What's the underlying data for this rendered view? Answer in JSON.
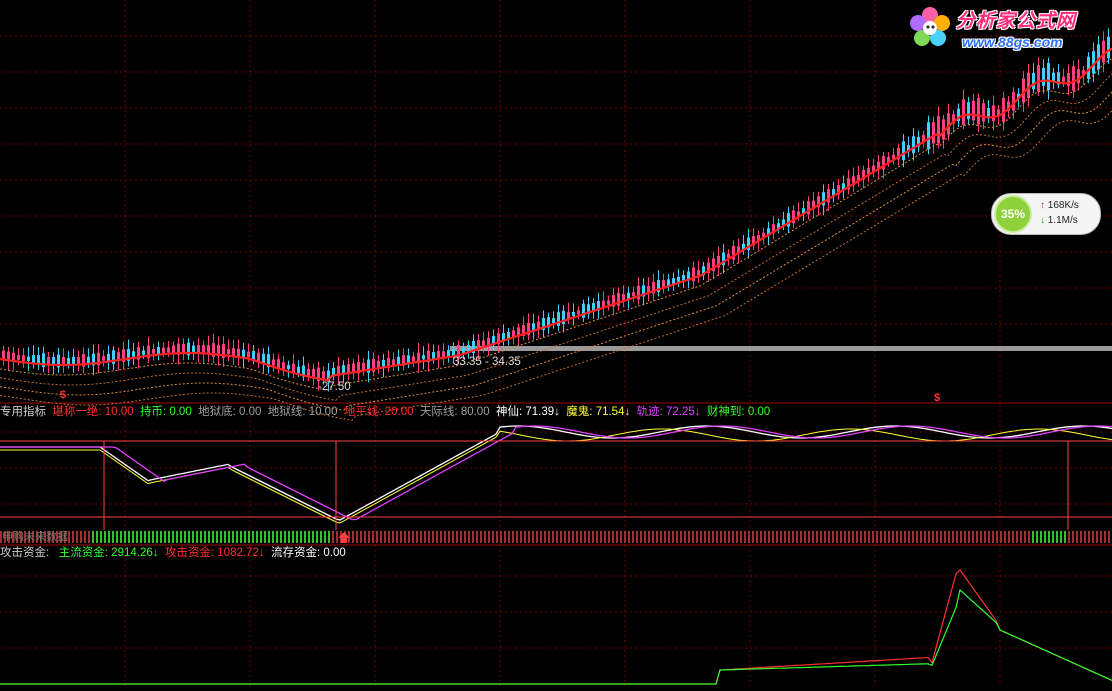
{
  "chart_data": [
    {
      "type": "candlestick",
      "panel": "price",
      "annotations": {
        "high_label": "33.35 - 34.35",
        "low_label": "27.50"
      }
    },
    {
      "type": "line",
      "panel": "indicator",
      "title": "专用指标",
      "legend": [
        {
          "name": "堪称一绝",
          "value": "10.00",
          "color": "#ff3030"
        },
        {
          "name": "持币",
          "value": "0.00",
          "color": "#30ff30"
        },
        {
          "name": "地狱底",
          "value": "0.00",
          "color": "#a0a0a0"
        },
        {
          "name": "地狱线",
          "value": "10.00",
          "color": "#a0a0a0"
        },
        {
          "name": "地平线",
          "value": "20.00",
          "color": "#ff3030"
        },
        {
          "name": "天际线",
          "value": "80.00",
          "color": "#a0a0a0"
        },
        {
          "name": "神仙",
          "value": "71.39",
          "color": "#ffffff",
          "arrow": "down"
        },
        {
          "name": "魔鬼",
          "value": "71.54",
          "color": "#ffff30",
          "arrow": "down"
        },
        {
          "name": "轨迹",
          "value": "72.25",
          "color": "#e040ff",
          "arrow": "down"
        },
        {
          "name": "财神到",
          "value": "0.00",
          "color": "#30ff30"
        }
      ]
    },
    {
      "type": "line",
      "panel": "capital",
      "legend": [
        {
          "name": "攻击资金",
          "value": "",
          "color": "#ffffff"
        },
        {
          "name": "主流资金",
          "value": "2914.26",
          "color": "#30ff30",
          "arrow": "down"
        },
        {
          "name": "攻击资金",
          "value": "1082.72",
          "color": "#ff3030",
          "arrow": "down"
        },
        {
          "name": "流存资金",
          "value": "0.00",
          "color": "#ffffff"
        }
      ]
    }
  ],
  "watermark": {
    "title": "分析家公式网",
    "url": "www.88gs.com"
  },
  "strip_label": "申购未来数据",
  "net_widget": {
    "percent": "35%",
    "up": "168K/s",
    "down": "1.1M/s"
  },
  "colors": {
    "grid": "#7a0000",
    "up_candle": "#ff4080",
    "down_candle": "#40d0ff",
    "bull_line": "#ff2020",
    "bear_line": "#30ff30"
  }
}
